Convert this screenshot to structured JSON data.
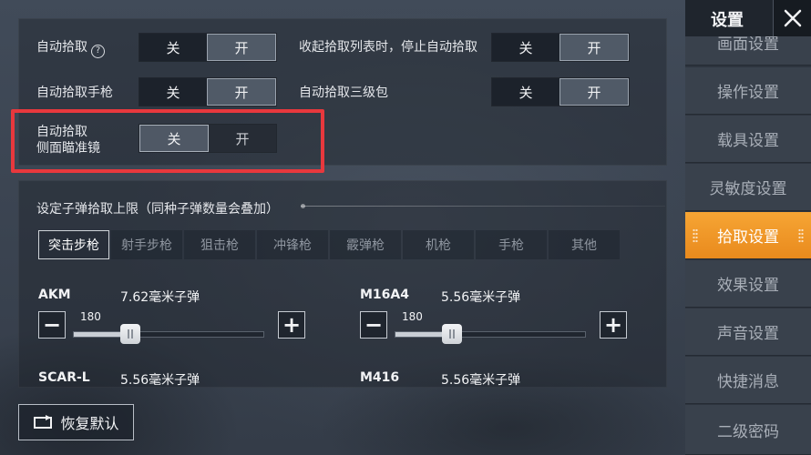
{
  "sidebar": {
    "title": "设置",
    "items": [
      {
        "label": "画面设置"
      },
      {
        "label": "操作设置"
      },
      {
        "label": "载具设置"
      },
      {
        "label": "灵敏度设置"
      },
      {
        "label": "拾取设置",
        "active": true
      },
      {
        "label": "效果设置"
      },
      {
        "label": "声音设置"
      },
      {
        "label": "快捷消息"
      },
      {
        "label": "二级密码"
      }
    ]
  },
  "settings": {
    "auto_pickup": {
      "label": "自动拾取",
      "off": "关",
      "on": "开",
      "value": "on"
    },
    "stop_on_collapse": {
      "label": "收起拾取列表时，停止自动拾取",
      "off": "关",
      "on": "开",
      "value": "on"
    },
    "auto_pickup_pistol": {
      "label": "自动拾取手枪",
      "off": "关",
      "on": "开",
      "value": "on"
    },
    "auto_pickup_lvl3_bag": {
      "label": "自动拾取三级包",
      "off": "关",
      "on": "开",
      "value": "on"
    },
    "auto_pickup_side_scope": {
      "label_line1": "自动拾取",
      "label_line2": "侧面瞄准镜",
      "off": "关",
      "on": "开",
      "value": "off"
    }
  },
  "ammo": {
    "title": "设定子弹拾取上限（同种子弹数量会叠加）",
    "tabs": [
      "突击步枪",
      "射手步枪",
      "狙击枪",
      "冲锋枪",
      "霰弹枪",
      "机枪",
      "手枪",
      "其他"
    ],
    "active_tab": 0,
    "slider_max": 600,
    "weapons": [
      {
        "name": "AKM",
        "ammo": "7.62毫米子弹",
        "value": 180
      },
      {
        "name": "M16A4",
        "ammo": "5.56毫米子弹",
        "value": 180
      },
      {
        "name": "SCAR-L",
        "ammo": "5.56毫米子弹"
      },
      {
        "name": "M416",
        "ammo": "5.56毫米子弹"
      }
    ]
  },
  "reset": {
    "label": "恢复默认"
  },
  "colors": {
    "accent": "#f39c2a",
    "highlight": "#e8383d"
  }
}
